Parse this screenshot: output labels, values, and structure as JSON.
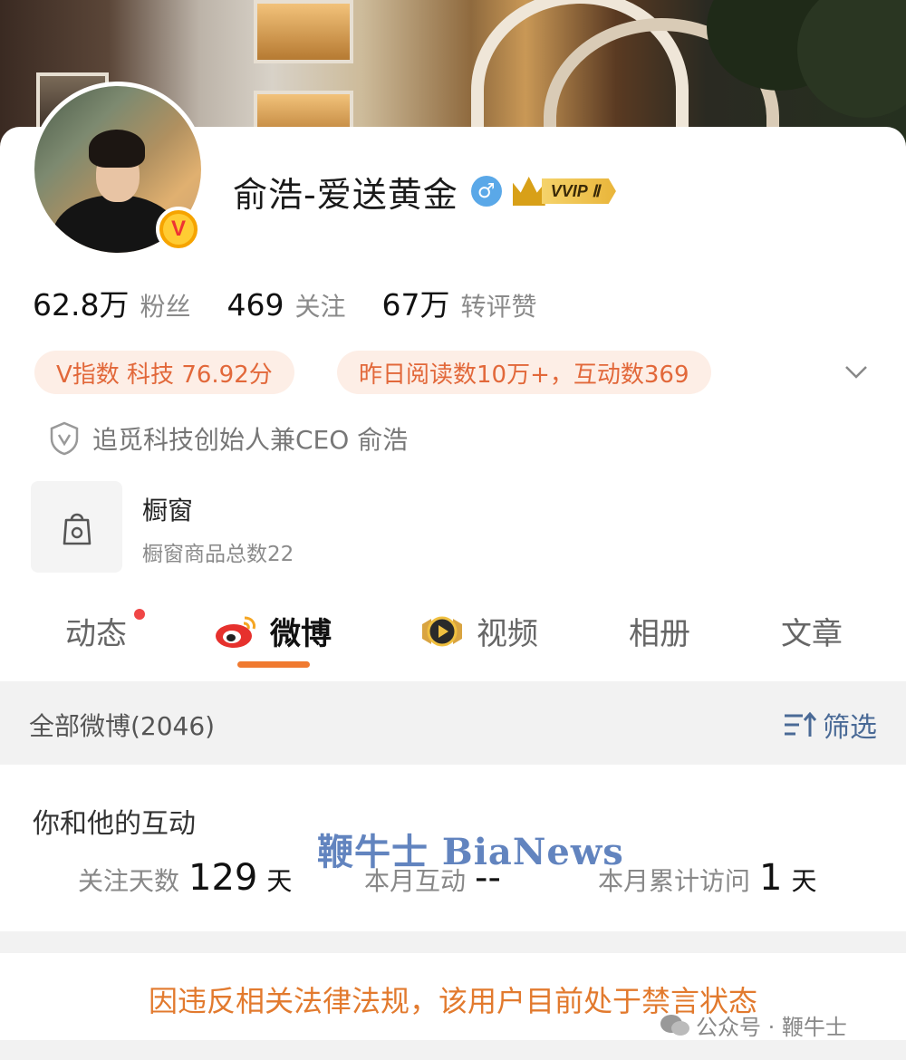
{
  "profile": {
    "name": "俞浩-爱送黄金",
    "gender_symbol": "♂",
    "vip_label": "VVIP Ⅱ",
    "verified_badge": "V"
  },
  "stats": [
    {
      "num": "62.8万",
      "label": "粉丝"
    },
    {
      "num": "469",
      "label": "关注"
    },
    {
      "num": "67万",
      "label": "转评赞"
    }
  ],
  "pills": {
    "v_index": "V指数 科技 76.92分",
    "reads": "昨日阅读数10万+，互动数369"
  },
  "certification": "追觅科技创始人兼CEO 俞浩",
  "shop": {
    "title": "橱窗",
    "subtitle": "橱窗商品总数22"
  },
  "tabs": [
    {
      "label": "动态"
    },
    {
      "label": "微博"
    },
    {
      "label": "视频"
    },
    {
      "label": "相册"
    },
    {
      "label": "文章"
    }
  ],
  "filter": {
    "all_label": "全部微博(2046)",
    "filter_label": "筛选"
  },
  "interaction": {
    "title": "你和他的互动",
    "follow_days_label": "关注天数",
    "follow_days_value": "129",
    "follow_days_unit": "天",
    "month_interact_label": "本月互动",
    "month_interact_value": "--",
    "month_visit_label": "本月累计访问",
    "month_visit_value": "1",
    "month_visit_unit": "天"
  },
  "banned_notice": "因违反相关法律法规，该用户目前处于禁言状态",
  "watermark": {
    "brand": "鞭牛士 BiaNews",
    "source": "公众号 · 鞭牛士"
  },
  "colors": {
    "accent_orange": "#f07a30",
    "pill_bg": "#fdeee6",
    "pill_text": "#e2683a",
    "link_blue": "#4a6a96",
    "notice_orange": "#e27a2e"
  }
}
